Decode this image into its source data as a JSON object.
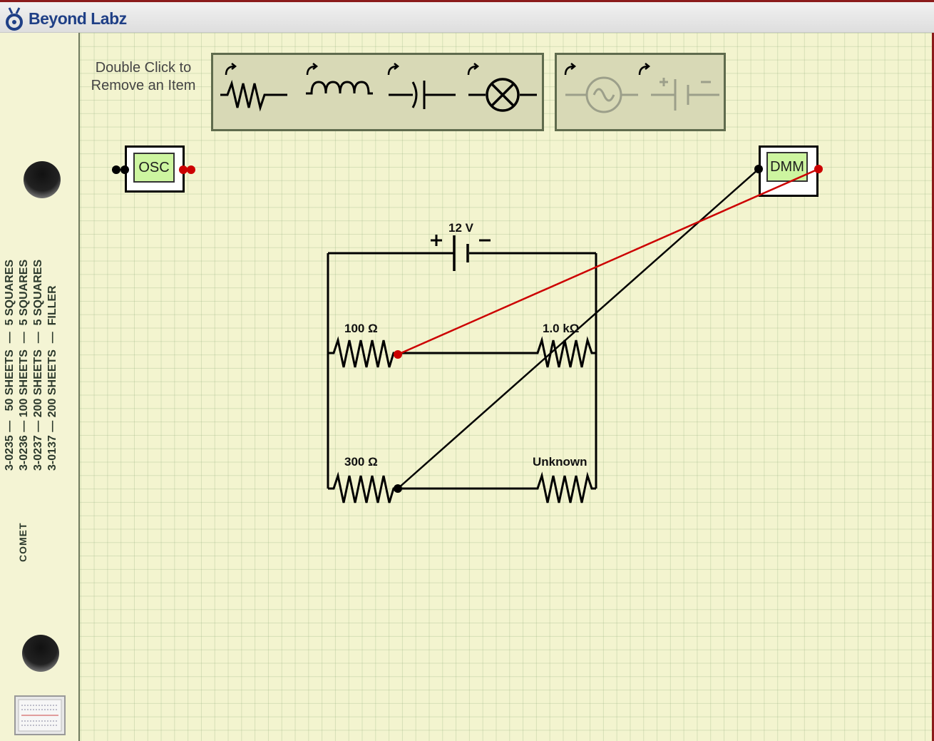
{
  "header": {
    "brand": "Beyond Labz"
  },
  "sidebar": {
    "sheet_lines": "3-0235 —   50 SHEETS  —  5 SQUARES\n3-0236 — 100 SHEETS  —  5 SQUARES\n3-0237 — 200 SHEETS  —  5 SQUARES\n3-0137 — 200 SHEETS  —  FILLER",
    "brand_mark": "COMET"
  },
  "toolbar": {
    "hint_line1": "Double Click to",
    "hint_line2": "Remove an Item"
  },
  "instruments": {
    "osc_label": "OSC",
    "dmm_label": "DMM"
  },
  "circuit": {
    "battery_label": "12 V",
    "resistor_top_left": "100 Ω",
    "resistor_top_right": "1.0 kΩ",
    "resistor_bottom_left": "300 Ω",
    "resistor_bottom_right": "Unknown"
  },
  "colors": {
    "accent_red": "#cc0000",
    "brand_blue": "#1f3f86",
    "screen_green": "#cdf5a0"
  }
}
